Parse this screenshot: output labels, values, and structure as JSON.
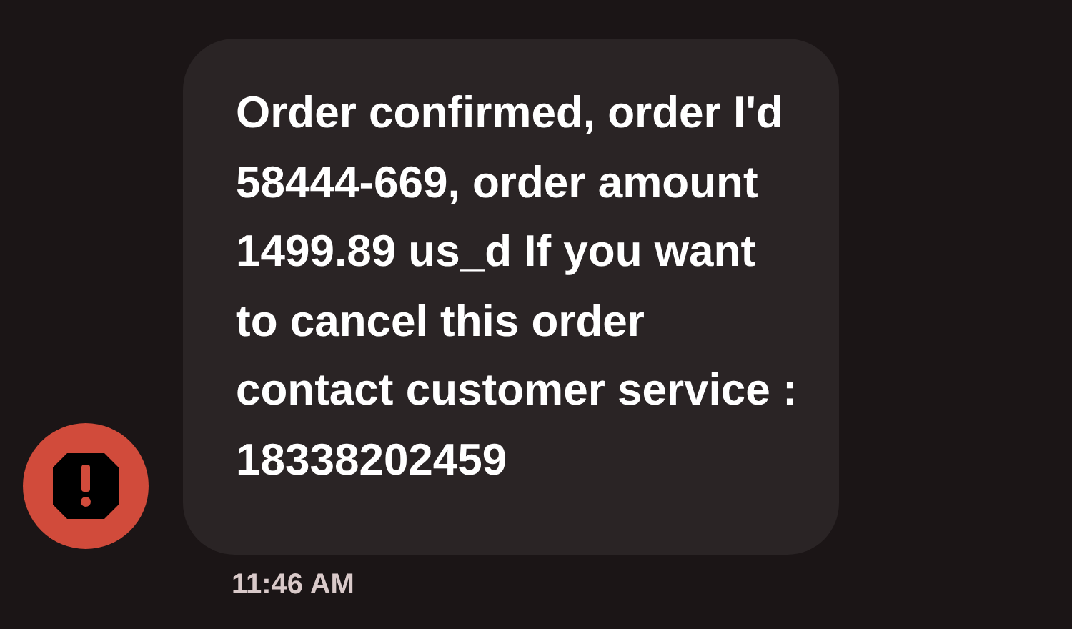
{
  "message": {
    "text": "Order confirmed, order I'd 58444-669, order amount 1499.89 us_d If you want to cancel this order contact customer service : 18338202459",
    "error": true,
    "time": "11:46 AM"
  }
}
